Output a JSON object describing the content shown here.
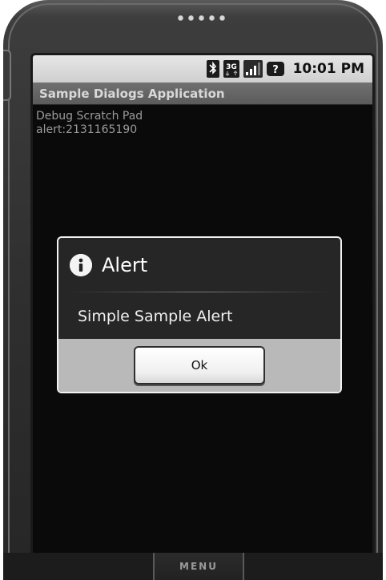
{
  "status_bar": {
    "icons": [
      "bluetooth-icon",
      "3g-icon",
      "signal-icon",
      "notification-icon"
    ],
    "time": "10:01 PM"
  },
  "app": {
    "title": "Sample Dialogs Application",
    "content_lines": [
      "Debug Scratch Pad",
      "alert:2131165190"
    ]
  },
  "dialog": {
    "icon": "info-icon",
    "title": "Alert",
    "message": "Simple Sample Alert",
    "ok_label": "Ok"
  },
  "device": {
    "menu_label": "MENU"
  }
}
